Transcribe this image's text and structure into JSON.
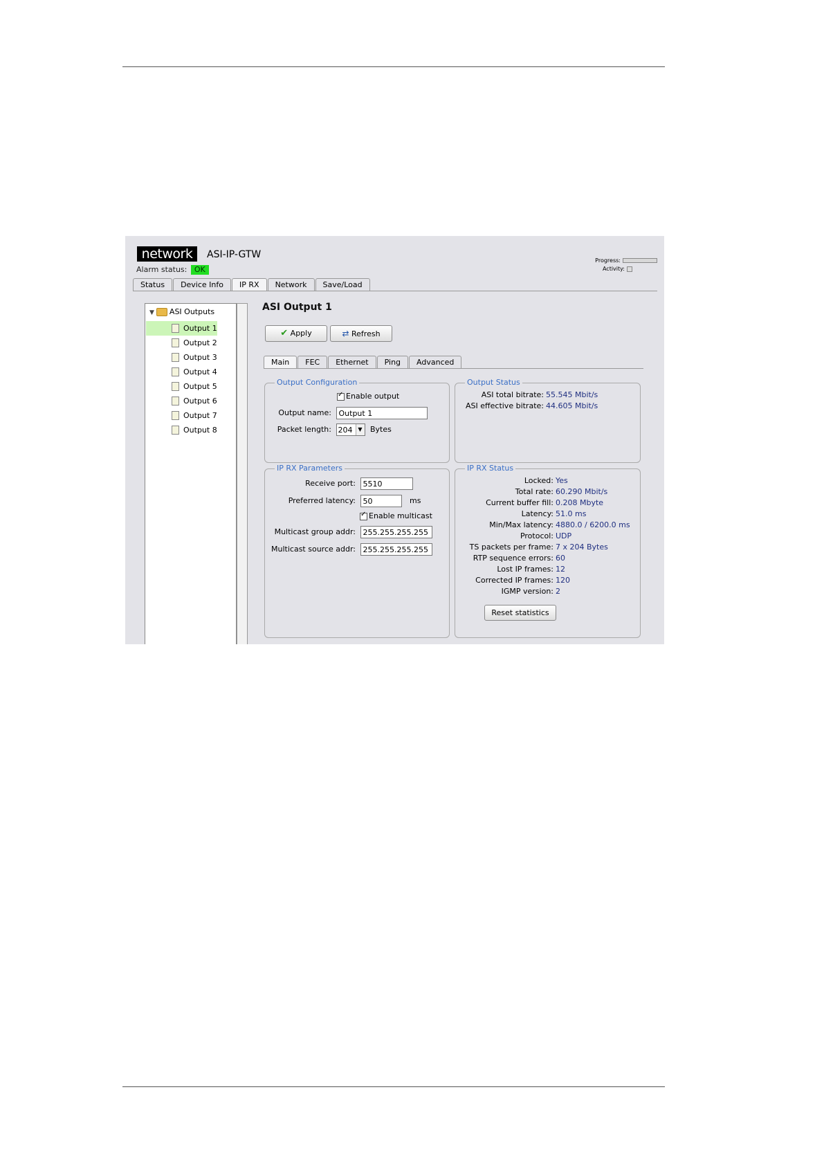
{
  "brand": {
    "logo": "network",
    "device_name": "ASI-IP-GTW"
  },
  "alarm": {
    "label": "Alarm status:",
    "value": "OK"
  },
  "indicators": {
    "progress_label": "Progress:",
    "activity_label": "Activity:",
    "progress": 0
  },
  "top_tabs": [
    {
      "label": "Status"
    },
    {
      "label": "Device Info"
    },
    {
      "label": "IP RX",
      "active": true
    },
    {
      "label": "Network"
    },
    {
      "label": "Save/Load"
    }
  ],
  "tree": {
    "root": "ASI Outputs",
    "items": [
      "Output 1",
      "Output 2",
      "Output 3",
      "Output 4",
      "Output 5",
      "Output 6",
      "Output 7",
      "Output 8"
    ],
    "selected": "Output 1"
  },
  "page": {
    "title": "ASI Output 1"
  },
  "buttons": {
    "apply": "Apply",
    "refresh": "Refresh",
    "reset": "Reset statistics"
  },
  "sub_tabs": [
    {
      "label": "Main",
      "active": true
    },
    {
      "label": "FEC"
    },
    {
      "label": "Ethernet"
    },
    {
      "label": "Ping"
    },
    {
      "label": "Advanced"
    }
  ],
  "output_config": {
    "title": "Output Configuration",
    "enable_output": "Enable output",
    "name_label": "Output name:",
    "name_value": "Output 1",
    "packet_label": "Packet length:",
    "packet_value": "204",
    "packet_unit": "Bytes"
  },
  "output_status": {
    "title": "Output Status",
    "total_label": "ASI total bitrate:",
    "total_value": "55.545 Mbit/s",
    "effective_label": "ASI effective bitrate:",
    "effective_value": "44.605 Mbit/s"
  },
  "ip_rx_params": {
    "title": "IP RX Parameters",
    "port_label": "Receive port:",
    "port_value": "5510",
    "latency_label": "Preferred latency:",
    "latency_value": "50",
    "latency_unit": "ms",
    "multicast": "Enable multicast",
    "group_label": "Multicast group addr:",
    "group_value": "255.255.255.255",
    "source_label": "Multicast source addr:",
    "source_value": "255.255.255.255"
  },
  "ip_rx_status": {
    "title": "IP RX Status",
    "rows": [
      {
        "label": "Locked:",
        "value": "Yes"
      },
      {
        "label": "Total rate:",
        "value": "60.290 Mbit/s"
      },
      {
        "label": "Current buffer fill:",
        "value": "0.208 Mbyte"
      },
      {
        "label": "Latency:",
        "value": "51.0 ms"
      },
      {
        "label": "Min/Max latency:",
        "value": "4880.0 / 6200.0 ms"
      },
      {
        "label": "Protocol:",
        "value": "UDP"
      },
      {
        "label": "TS packets per frame:",
        "value": "7 x 204 Bytes"
      },
      {
        "label": "RTP sequence errors:",
        "value": "60"
      },
      {
        "label": "Lost IP frames:",
        "value": "12"
      },
      {
        "label": "Corrected IP frames:",
        "value": "120"
      },
      {
        "label": "IGMP version:",
        "value": "2"
      }
    ]
  }
}
